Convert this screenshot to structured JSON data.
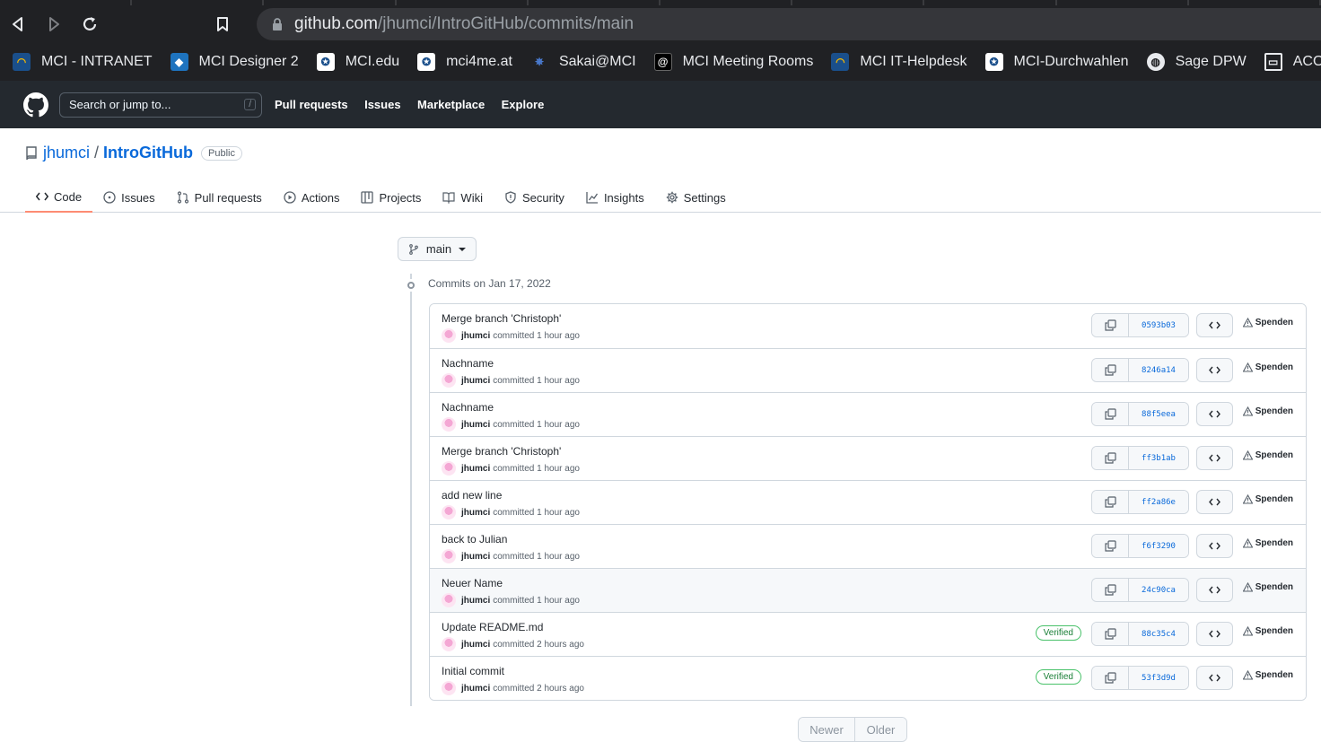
{
  "browser": {
    "url_host": "github.com",
    "url_path": "/jhumci/IntroGitHub/commits/main",
    "bookmarks": [
      {
        "label": "MCI - INTRANET",
        "icon": "mci-icon"
      },
      {
        "label": "MCI Designer 2",
        "icon": "designer-icon"
      },
      {
        "label": "MCI.edu",
        "icon": "mci-shield-icon"
      },
      {
        "label": "mci4me.at",
        "icon": "mci-shield-icon"
      },
      {
        "label": "Sakai@MCI",
        "icon": "sakai-icon"
      },
      {
        "label": "MCI Meeting Rooms",
        "icon": "at-icon"
      },
      {
        "label": "MCI IT-Helpdesk",
        "icon": "mci-icon"
      },
      {
        "label": "MCI-Durchwahlen",
        "icon": "mci-shield-icon"
      },
      {
        "label": "Sage DPW",
        "icon": "globe-icon"
      },
      {
        "label": "ACOnet FileSender",
        "icon": "filesender-icon"
      }
    ]
  },
  "github": {
    "search_placeholder": "Search or jump to...",
    "search_key": "/",
    "nav": [
      "Pull requests",
      "Issues",
      "Marketplace",
      "Explore"
    ]
  },
  "repo": {
    "owner": "jhumci",
    "separator": "/",
    "name": "IntroGitHub",
    "visibility": "Public",
    "tabs": [
      {
        "label": "Code",
        "icon": "code-icon"
      },
      {
        "label": "Issues",
        "icon": "issue-icon"
      },
      {
        "label": "Pull requests",
        "icon": "pull-request-icon"
      },
      {
        "label": "Actions",
        "icon": "play-icon"
      },
      {
        "label": "Projects",
        "icon": "project-icon"
      },
      {
        "label": "Wiki",
        "icon": "book-icon"
      },
      {
        "label": "Security",
        "icon": "shield-icon"
      },
      {
        "label": "Insights",
        "icon": "graph-icon"
      },
      {
        "label": "Settings",
        "icon": "gear-icon"
      }
    ]
  },
  "branch": "main",
  "commits_heading": "Commits on Jan 17, 2022",
  "committed_text": "committed",
  "spenden_label": "Spenden",
  "commits": [
    {
      "message": "Merge branch 'Christoph'",
      "author": "jhumci",
      "time": "1 hour ago",
      "sha": "0593b03",
      "verified": ""
    },
    {
      "message": "Nachname",
      "author": "jhumci",
      "time": "1 hour ago",
      "sha": "8246a14",
      "verified": ""
    },
    {
      "message": "Nachname",
      "author": "jhumci",
      "time": "1 hour ago",
      "sha": "88f5eea",
      "verified": ""
    },
    {
      "message": "Merge branch 'Christoph'",
      "author": "jhumci",
      "time": "1 hour ago",
      "sha": "ff3b1ab",
      "verified": ""
    },
    {
      "message": "add new line",
      "author": "jhumci",
      "time": "1 hour ago",
      "sha": "ff2a86e",
      "verified": ""
    },
    {
      "message": "back to Julian",
      "author": "jhumci",
      "time": "1 hour ago",
      "sha": "f6f3290",
      "verified": ""
    },
    {
      "message": "Neuer Name",
      "author": "jhumci",
      "time": "1 hour ago",
      "sha": "24c90ca",
      "verified": ""
    },
    {
      "message": "Update README.md",
      "author": "jhumci",
      "time": "2 hours ago",
      "sha": "88c35c4",
      "verified": "Verified"
    },
    {
      "message": "Initial commit",
      "author": "jhumci",
      "time": "2 hours ago",
      "sha": "53f3d9d",
      "verified": "Verified"
    }
  ],
  "pager": {
    "newer": "Newer",
    "older": "Older"
  },
  "colors": {
    "accent": "#0969da",
    "tab_underline": "#fd8c73",
    "header_bg": "#24292f",
    "verified": "#1a7f37"
  }
}
